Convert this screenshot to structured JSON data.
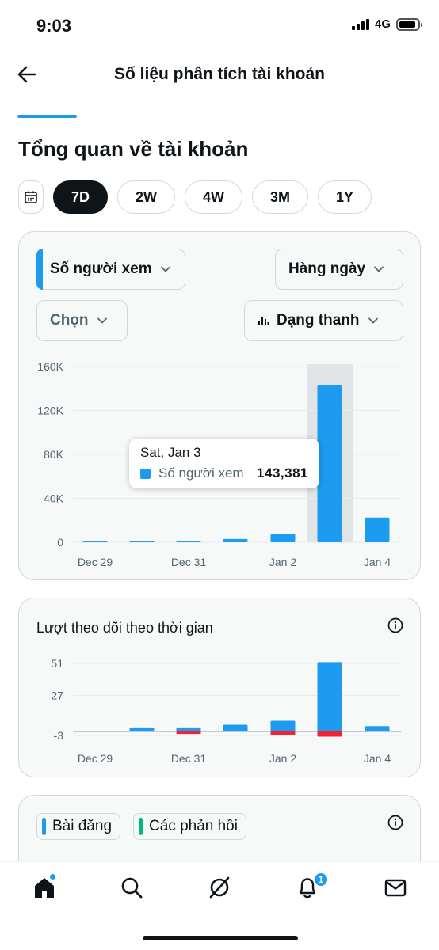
{
  "status_bar": {
    "time": "9:03",
    "network": "4G"
  },
  "header": {
    "title": "Số liệu phân tích tài khoản"
  },
  "section": {
    "title": "Tổng quan về tài khoản"
  },
  "time_ranges": [
    {
      "label": "7D",
      "active": true
    },
    {
      "label": "2W",
      "active": false
    },
    {
      "label": "4W",
      "active": false
    },
    {
      "label": "3M",
      "active": false
    },
    {
      "label": "1Y",
      "active": false
    }
  ],
  "overview_card": {
    "metric_dropdown": "Số người xem",
    "interval_dropdown": "Hàng ngày",
    "compare_dropdown": "Chọn",
    "chart_type_dropdown": "Dạng thanh",
    "tooltip": {
      "date": "Sat, Jan 3",
      "label": "Số người xem",
      "value": "143,381"
    }
  },
  "followers_card": {
    "title": "Lượt theo dõi theo thời gian"
  },
  "posts_card": {
    "legend": [
      {
        "label": "Bài đăng",
        "color": "#1d9bf0"
      },
      {
        "label": "Các phản hồi",
        "color": "#00ba7c"
      }
    ]
  },
  "bottom_nav": {
    "items": [
      "home-icon",
      "search-icon",
      "grok-icon",
      "notifications-icon",
      "messages-icon"
    ],
    "notification_count": "1"
  },
  "colors": {
    "accent": "#1d9bf0",
    "negative": "#f4212e",
    "highlight": "#e1e4e6"
  },
  "chart_data": [
    {
      "type": "bar",
      "title": "",
      "x_tick_labels": [
        "Dec 29",
        "Dec 31",
        "Jan 2",
        "Jan 4"
      ],
      "categories": [
        "Dec 29",
        "Dec 30",
        "Dec 31",
        "Jan 1",
        "Jan 2",
        "Jan 3",
        "Jan 4"
      ],
      "series": [
        {
          "name": "Số người xem",
          "values": [
            800,
            700,
            900,
            3000,
            7500,
            143381,
            22500
          ]
        }
      ],
      "y_ticks": [
        "0",
        "40K",
        "80K",
        "120K",
        "160K"
      ],
      "ylim": [
        0,
        160000
      ],
      "highlighted_category": "Jan 3",
      "grid": true
    },
    {
      "type": "bar",
      "title": "Lượt theo dõi theo thời gian",
      "x_tick_labels": [
        "Dec 29",
        "Dec 31",
        "Jan 2",
        "Jan 4"
      ],
      "categories": [
        "Dec 29",
        "Dec 30",
        "Dec 31",
        "Jan 1",
        "Jan 2",
        "Jan 3",
        "Jan 4"
      ],
      "series": [
        {
          "values": [
            0,
            3,
            3,
            5,
            8,
            52,
            4
          ]
        },
        {
          "values": [
            0,
            0,
            -1,
            0,
            -2,
            -3,
            0
          ]
        }
      ],
      "y_ticks": [
        "-3",
        "27",
        "51"
      ],
      "ylim": [
        -3,
        51
      ],
      "grid": true
    }
  ]
}
